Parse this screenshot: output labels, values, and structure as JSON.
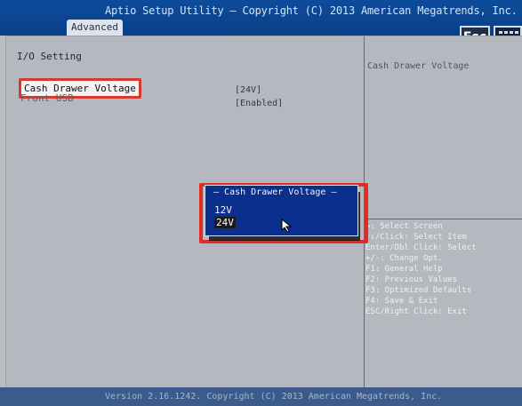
{
  "header": {
    "title": "Aptio Setup Utility – Copyright (C) 2013 American Megatrends, Inc.",
    "tab": "Advanced",
    "esc_label": "Esc"
  },
  "main": {
    "page_title": "I/O Setting",
    "items": [
      {
        "label": "Cash Drawer Voltage",
        "value": "[24V]"
      },
      {
        "label": "Front USB",
        "value": "[Enabled]"
      }
    ]
  },
  "help": {
    "item_title": "Cash Drawer Voltage",
    "keys": [
      "↔: Select Screen",
      "↑↓/Click: Select Item",
      "Enter/Dbl Click: Select",
      "+/-: Change Opt.",
      "F1: General Help",
      "F2: Previous Values",
      "F3: Optimized Defaults",
      "F4: Save & Exit",
      "ESC/Right Click: Exit"
    ]
  },
  "popup": {
    "title": "Cash Drawer Voltage",
    "options": [
      "12V",
      "24V"
    ],
    "selected": "24V"
  },
  "footer": {
    "text": "Version 2.16.1242. Copyright (C) 2013 American Megatrends, Inc."
  },
  "colors": {
    "header_blue": "#0d4c9b",
    "popup_blue": "#0b2f8d",
    "annotation_red": "#df2d23"
  }
}
